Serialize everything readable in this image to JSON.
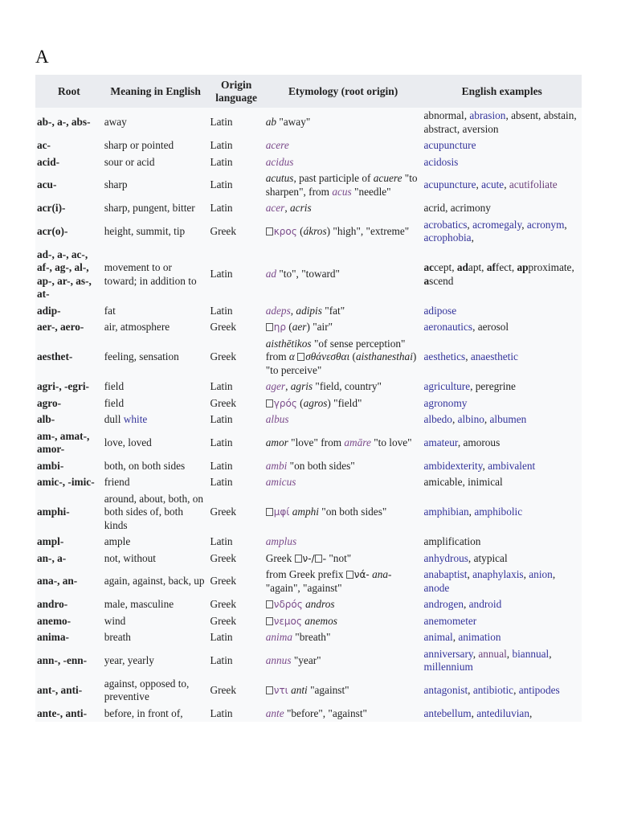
{
  "section": {
    "heading": "A"
  },
  "table": {
    "headers": [
      "Root",
      "Meaning in English",
      "Origin language",
      "Etymology (root origin)",
      "English examples"
    ],
    "rows": [
      {
        "root": "ab-, a-, abs-",
        "meaning": "away",
        "language": "Latin",
        "etymology": [
          {
            "t": "ab",
            "s": "it"
          },
          {
            "t": " \"away\""
          }
        ],
        "examples": [
          {
            "t": "abnormal, "
          },
          {
            "t": "abrasion",
            "s": "lnk"
          },
          {
            "t": ", absent, abstain, abstract, aversion"
          }
        ]
      },
      {
        "root": "ac-",
        "meaning": "sharp or pointed",
        "language": "Latin",
        "etymology": [
          {
            "t": "acere",
            "s": "ety-link"
          }
        ],
        "examples": [
          {
            "t": "acupuncture",
            "s": "lnk"
          }
        ]
      },
      {
        "root": "acid-",
        "meaning": "sour or acid",
        "language": "Latin",
        "etymology": [
          {
            "t": "acidus",
            "s": "ety-link"
          }
        ],
        "examples": [
          {
            "t": "acidosis",
            "s": "lnk"
          }
        ]
      },
      {
        "root": "acu-",
        "meaning": "sharp",
        "language": "Latin",
        "etymology": [
          {
            "t": "acutus",
            "s": "it"
          },
          {
            "t": ", past participle of "
          },
          {
            "t": "acuere",
            "s": "it"
          },
          {
            "t": " \"to sharpen\", from "
          },
          {
            "t": "acus",
            "s": "ety-link"
          },
          {
            "t": " \"needle\""
          }
        ],
        "examples": [
          {
            "t": "acupuncture",
            "s": "lnk"
          },
          {
            "t": ", "
          },
          {
            "t": "acute",
            "s": "lnk"
          },
          {
            "t": ", "
          },
          {
            "t": "acutifoliate",
            "s": "vlnk"
          }
        ]
      },
      {
        "root": "acr(i)-",
        "meaning": "sharp, pungent, bitter",
        "language": "Latin",
        "etymology": [
          {
            "t": "acer",
            "s": "ety-link"
          },
          {
            "t": ", "
          },
          {
            "t": "acris",
            "s": "it"
          }
        ],
        "examples": [
          {
            "t": "acrid, acrimony"
          }
        ]
      },
      {
        "root": "acr(o)-",
        "meaning": "height, summit, tip",
        "language": "Greek",
        "etymology": [
          {
            "t": "",
            "s": "box"
          },
          {
            "t": "κρος",
            "s": "gk-link"
          },
          {
            "t": " ("
          },
          {
            "t": "ákros",
            "s": "it"
          },
          {
            "t": ") \"high\", \"extreme\""
          }
        ],
        "examples": [
          {
            "t": "acrobatics",
            "s": "lnk"
          },
          {
            "t": ", "
          },
          {
            "t": "acromegaly",
            "s": "lnk"
          },
          {
            "t": ", "
          },
          {
            "t": "acronym",
            "s": "lnk"
          },
          {
            "t": ", "
          },
          {
            "t": "acrophobia",
            "s": "lnk"
          },
          {
            "t": ","
          }
        ]
      },
      {
        "root": "ad-, a-, ac-, af-, ag-, al-, ap-, ar-, as-, at-",
        "meaning": "movement to or toward; in addition to",
        "language": "Latin",
        "etymology": [
          {
            "t": "ad",
            "s": "ety-link"
          },
          {
            "t": " \"to\", \"toward\""
          }
        ],
        "examples": [
          {
            "t": "ac",
            "s": "b"
          },
          {
            "t": "cept, "
          },
          {
            "t": "ad",
            "s": "b"
          },
          {
            "t": "apt, "
          },
          {
            "t": "af",
            "s": "b"
          },
          {
            "t": "fect, "
          },
          {
            "t": "ap",
            "s": "b"
          },
          {
            "t": "proximate, "
          },
          {
            "t": "a",
            "s": "b"
          },
          {
            "t": "scend"
          }
        ]
      },
      {
        "root": "adip-",
        "meaning": "fat",
        "language": "Latin",
        "etymology": [
          {
            "t": "adeps",
            "s": "ety-link"
          },
          {
            "t": ", "
          },
          {
            "t": "adipis",
            "s": "it"
          },
          {
            "t": " \"fat\""
          }
        ],
        "examples": [
          {
            "t": "adipose",
            "s": "lnk"
          }
        ]
      },
      {
        "root": "aer-, aero-",
        "meaning": "air, atmosphere",
        "language": "Greek",
        "etymology": [
          {
            "t": "",
            "s": "box"
          },
          {
            "t": "ηρ",
            "s": "gk-link"
          },
          {
            "t": " ("
          },
          {
            "t": "aer",
            "s": "it"
          },
          {
            "t": ") \"air\""
          }
        ],
        "examples": [
          {
            "t": "aeronautics",
            "s": "lnk"
          },
          {
            "t": ", aerosol"
          }
        ]
      },
      {
        "root": "aesthet-",
        "meaning": "feeling, sensation",
        "language": "Greek",
        "etymology": [
          {
            "t": "aisthētikos",
            "s": "it"
          },
          {
            "t": " \"of sense perception\" from "
          },
          {
            "t": "α ",
            "s": "it"
          },
          {
            "t": "",
            "s": "box"
          },
          {
            "t": "σθάνεσθαι",
            "s": "it"
          },
          {
            "t": " ("
          },
          {
            "t": "aisthanesthai",
            "s": "it"
          },
          {
            "t": ") \"to perceive\""
          }
        ],
        "examples": [
          {
            "t": "aesthetics",
            "s": "lnk"
          },
          {
            "t": ", "
          },
          {
            "t": "anaesthetic",
            "s": "lnk"
          }
        ]
      },
      {
        "root": "agri-, -egri-",
        "meaning": "field",
        "language": "Latin",
        "etymology": [
          {
            "t": "ager",
            "s": "ety-link"
          },
          {
            "t": ", "
          },
          {
            "t": "agris",
            "s": "it"
          },
          {
            "t": " \"field, country\""
          }
        ],
        "examples": [
          {
            "t": "agriculture",
            "s": "lnk"
          },
          {
            "t": ", peregrine"
          }
        ]
      },
      {
        "root": "agro-",
        "meaning": "field",
        "language": "Greek",
        "etymology": [
          {
            "t": "",
            "s": "box"
          },
          {
            "t": "γρός",
            "s": "gk-link"
          },
          {
            "t": " ("
          },
          {
            "t": "agros",
            "s": "it"
          },
          {
            "t": ") \"field\""
          }
        ],
        "examples": [
          {
            "t": "agronomy",
            "s": "lnk"
          }
        ]
      },
      {
        "root": "alb-",
        "meaning_parts": [
          {
            "t": "dull "
          },
          {
            "t": "white",
            "s": "lnk"
          }
        ],
        "meaning": "dull white",
        "language": "Latin",
        "etymology": [
          {
            "t": "albus",
            "s": "ety-link"
          }
        ],
        "examples": [
          {
            "t": "albedo",
            "s": "lnk"
          },
          {
            "t": ", "
          },
          {
            "t": "albino",
            "s": "lnk"
          },
          {
            "t": ", "
          },
          {
            "t": "albumen",
            "s": "lnk"
          }
        ]
      },
      {
        "root": "am-, amat-, amor-",
        "meaning": "love, loved",
        "language": "Latin",
        "etymology": [
          {
            "t": "amor",
            "s": "it"
          },
          {
            "t": " \"love\" from "
          },
          {
            "t": "amāre",
            "s": "ety-link"
          },
          {
            "t": " \"to love\""
          }
        ],
        "examples": [
          {
            "t": "amateur",
            "s": "lnk"
          },
          {
            "t": ", amorous"
          }
        ]
      },
      {
        "root": "ambi-",
        "meaning": "both, on both sides",
        "language": "Latin",
        "etymology": [
          {
            "t": "ambi",
            "s": "ety-link"
          },
          {
            "t": " \"on both sides\""
          }
        ],
        "examples": [
          {
            "t": "ambidexterity",
            "s": "lnk"
          },
          {
            "t": ", "
          },
          {
            "t": "ambivalent",
            "s": "lnk"
          }
        ]
      },
      {
        "root": "amic-, -imic-",
        "meaning": "friend",
        "language": "Latin",
        "etymology": [
          {
            "t": "amicus",
            "s": "ety-link"
          }
        ],
        "examples": [
          {
            "t": "amicable, inimical"
          }
        ]
      },
      {
        "root": "amphi-",
        "meaning": "around, about, both, on both sides of, both kinds",
        "language": "Greek",
        "etymology": [
          {
            "t": "",
            "s": "box"
          },
          {
            "t": "μφί",
            "s": "gk-link"
          },
          {
            "t": " "
          },
          {
            "t": "amphi",
            "s": "it"
          },
          {
            "t": " \"on both sides\""
          }
        ],
        "examples": [
          {
            "t": "amphibian",
            "s": "lnk"
          },
          {
            "t": ", "
          },
          {
            "t": "amphibolic",
            "s": "lnk"
          }
        ]
      },
      {
        "root": "ampl-",
        "meaning": "ample",
        "language": "Latin",
        "etymology": [
          {
            "t": "amplus",
            "s": "ety-link"
          }
        ],
        "examples": [
          {
            "t": "amplification"
          }
        ]
      },
      {
        "root": "an-, a-",
        "meaning": "not, without",
        "language": "Greek",
        "etymology": [
          {
            "t": "Greek "
          },
          {
            "t": "",
            "s": "box"
          },
          {
            "t": "ν-/",
            "s": "gk"
          },
          {
            "t": "",
            "s": "box"
          },
          {
            "t": "- \"not\""
          }
        ],
        "examples": [
          {
            "t": "anhydrous",
            "s": "lnk"
          },
          {
            "t": ", atypical"
          }
        ]
      },
      {
        "root": "ana-, an-",
        "meaning": "again, against, back, up",
        "language": "Greek",
        "etymology": [
          {
            "t": "from Greek prefix "
          },
          {
            "t": "",
            "s": "box"
          },
          {
            "t": "νά-",
            "s": "gk"
          },
          {
            "t": " "
          },
          {
            "t": "ana-",
            "s": "it"
          },
          {
            "t": " \"again\", \"against\""
          }
        ],
        "examples": [
          {
            "t": "anabaptist",
            "s": "lnk"
          },
          {
            "t": ", "
          },
          {
            "t": "anaphylaxis",
            "s": "lnk"
          },
          {
            "t": ", "
          },
          {
            "t": "anion",
            "s": "lnk"
          },
          {
            "t": ", "
          },
          {
            "t": "anode",
            "s": "lnk"
          }
        ]
      },
      {
        "root": "andro-",
        "meaning": "male, masculine",
        "language": "Greek",
        "etymology": [
          {
            "t": "",
            "s": "box"
          },
          {
            "t": "νδρός",
            "s": "gk-link"
          },
          {
            "t": " "
          },
          {
            "t": "andros",
            "s": "it"
          }
        ],
        "examples": [
          {
            "t": "androgen",
            "s": "lnk"
          },
          {
            "t": ", "
          },
          {
            "t": "android",
            "s": "lnk"
          }
        ]
      },
      {
        "root": "anemo-",
        "meaning": "wind",
        "language": "Greek",
        "etymology": [
          {
            "t": "",
            "s": "box"
          },
          {
            "t": "νεμος",
            "s": "gk-link"
          },
          {
            "t": " "
          },
          {
            "t": "anemos",
            "s": "it"
          }
        ],
        "examples": [
          {
            "t": "anemometer",
            "s": "lnk"
          }
        ]
      },
      {
        "root": "anima-",
        "meaning": "breath",
        "language": "Latin",
        "etymology": [
          {
            "t": "anima",
            "s": "ety-link"
          },
          {
            "t": " \"breath\""
          }
        ],
        "examples": [
          {
            "t": "animal",
            "s": "lnk"
          },
          {
            "t": ", "
          },
          {
            "t": "animation",
            "s": "lnk"
          }
        ]
      },
      {
        "root": "ann-, -enn-",
        "meaning": "year, yearly",
        "language": "Latin",
        "etymology": [
          {
            "t": "annus",
            "s": "ety-link"
          },
          {
            "t": " \"year\""
          }
        ],
        "examples": [
          {
            "t": "anniversary",
            "s": "lnk"
          },
          {
            "t": ", "
          },
          {
            "t": "annual",
            "s": "vlnk"
          },
          {
            "t": ", "
          },
          {
            "t": "biannual",
            "s": "lnk"
          },
          {
            "t": ", "
          },
          {
            "t": "millennium",
            "s": "lnk"
          }
        ]
      },
      {
        "root": "ant-, anti-",
        "meaning": "against, opposed to, preventive",
        "language": "Greek",
        "etymology": [
          {
            "t": "",
            "s": "box"
          },
          {
            "t": "ντι",
            "s": "gk-link"
          },
          {
            "t": " "
          },
          {
            "t": "anti",
            "s": "it"
          },
          {
            "t": " \"against\""
          }
        ],
        "examples": [
          {
            "t": "antagonist",
            "s": "lnk"
          },
          {
            "t": ", "
          },
          {
            "t": "antibiotic",
            "s": "lnk"
          },
          {
            "t": ", "
          },
          {
            "t": "antipodes",
            "s": "lnk"
          }
        ]
      },
      {
        "root": "ante-, anti-",
        "meaning": "before, in front of,",
        "language": "Latin",
        "etymology": [
          {
            "t": "ante",
            "s": "ety-link"
          },
          {
            "t": " \"before\", \"against\""
          }
        ],
        "examples": [
          {
            "t": "antebellum",
            "s": "lnk"
          },
          {
            "t": ", "
          },
          {
            "t": "antediluvian",
            "s": "lnk"
          },
          {
            "t": ","
          }
        ]
      }
    ]
  }
}
